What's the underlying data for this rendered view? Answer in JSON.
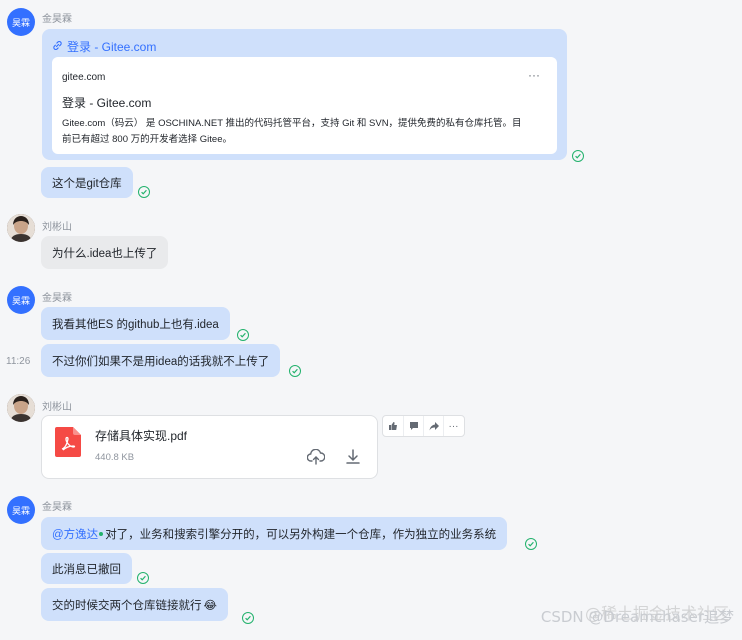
{
  "users": {
    "jin": {
      "name": "金昊霖",
      "avatar_text": "昊霖",
      "color": "#3370ff"
    },
    "liu": {
      "name": "刘彬山"
    }
  },
  "messages": {
    "m1": {
      "link_title": "登录 - Gitee.com",
      "card": {
        "domain": "gitee.com",
        "title": "登录 - Gitee.com",
        "description_line1": "Gitee.com（码云） 是 OSCHINA.NET 推出的代码托管平台，支持 Git 和 SVN，提供免费的私有仓库托管。目",
        "description_line2": "前已有超过 800 万的开发者选择 Gitee。",
        "more_label": "···"
      }
    },
    "m2": {
      "text": "这个是git仓库"
    },
    "m3": {
      "text": "为什么.idea也上传了"
    },
    "m4": {
      "text": "我看其他ES 的github上也有.idea"
    },
    "m5": {
      "text": "不过你们如果不是用idea的话我就不上传了",
      "time": "11:26"
    },
    "m6": {
      "file_name": "存储具体实现.pdf",
      "file_size": "440.8 KB"
    },
    "m7": {
      "mention": "@方逸达",
      "text": " 对了，业务和搜索引擎分开的，可以另外构建一个仓库，作为独立的业务系统"
    },
    "m8": {
      "text": "此消息已撤回"
    },
    "m9": {
      "text": "交的时候交两个仓库链接就行",
      "emoji": "😂"
    }
  },
  "toolbar": {
    "icons": [
      "thumbs-up-icon",
      "comment-icon",
      "forward-icon",
      "more-icon"
    ],
    "more_label": "···"
  },
  "watermark": "CSDN @Dreamchaser追梦",
  "watermark_overlay": "@稀土掘金技术社区",
  "colors": {
    "accent": "#3370ff",
    "bubble_self": "#cfe0fb",
    "bubble_other": "#e9eaec",
    "read_check": "#23b26d"
  }
}
